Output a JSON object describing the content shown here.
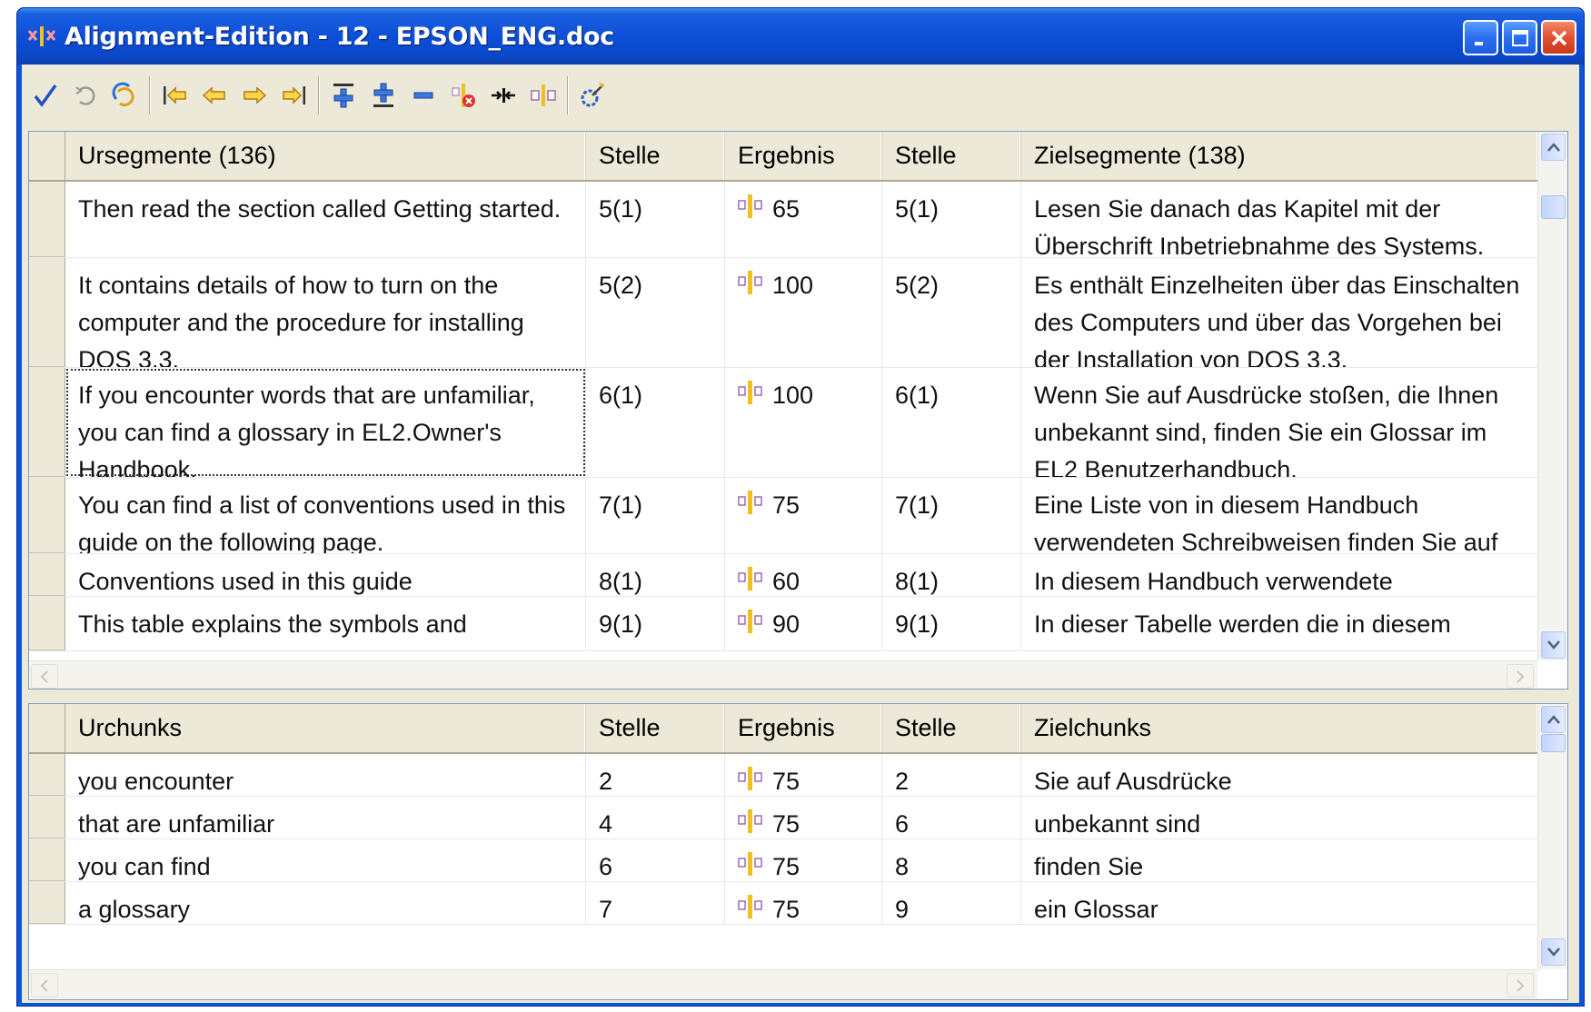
{
  "window": {
    "title": "Alignment-Edition - 12 - EPSON_ENG.doc",
    "buttons": [
      "minimize",
      "maximize",
      "close"
    ]
  },
  "toolbar": {
    "icons": [
      "confirm-check-icon",
      "refresh-icon",
      "refresh-all-icon",
      "first-icon",
      "previous-icon",
      "next-icon",
      "last-icon",
      "insert-above-icon",
      "insert-below-icon",
      "remove-icon",
      "delete-link-icon",
      "join-icon",
      "split-icon",
      "settings-wand-icon"
    ]
  },
  "segments": {
    "headers": [
      "Ursegmente (136)",
      "Stelle",
      "Ergebnis",
      "Stelle",
      "Zielsegmente (138)"
    ],
    "rows": [
      {
        "source": "Then read the section called Getting started.",
        "pos1": "5(1)",
        "score": "65",
        "pos2": "5(1)",
        "target": "Lesen Sie danach das Kapitel mit der Überschrift Inbetriebnahme des Systems."
      },
      {
        "source": " It contains details of how to turn on the computer and the procedure for installing DOS 3.3.",
        "pos1": "5(2)",
        "score": "100",
        "pos2": "5(2)",
        "target": " Es enthält Einzelheiten über das Einschalten des Computers und über das Vorgehen bei der Installation von DOS 3.3."
      },
      {
        "source": "If you encounter words that are unfamiliar, you can find a glossary in EL2.Owner's Handbook.",
        "pos1": "6(1)",
        "score": "100",
        "pos2": "6(1)",
        "target": "Wenn Sie auf Ausdrücke stoßen, die Ihnen unbekannt sind, finden Sie ein Glossar im EL2 Benutzerhandbuch."
      },
      {
        "source": "You can find a list of conventions used in this guide on the following page.",
        "pos1": "7(1)",
        "score": "75",
        "pos2": "7(1)",
        "target": "Eine Liste von in diesem Handbuch verwendeten Schreibweisen finden Sie auf der folgenden Seite."
      },
      {
        "source": "Conventions used in this guide",
        "pos1": "8(1)",
        "score": "60",
        "pos2": "8(1)",
        "target": "In diesem Handbuch verwendete Schreibweisen"
      },
      {
        "source": "This table explains the symbols and typefaces",
        "pos1": "9(1)",
        "score": "90",
        "pos2": "9(1)",
        "target": "In dieser Tabelle werden die in diesem Handbuch"
      }
    ]
  },
  "chunks": {
    "headers": [
      "Urchunks",
      "Stelle",
      "Ergebnis",
      "Stelle",
      "Zielchunks"
    ],
    "rows": [
      {
        "source": "you encounter",
        "pos1": "2",
        "score": "75",
        "pos2": "2",
        "target": "Sie auf Ausdrücke"
      },
      {
        "source": "that are unfamiliar",
        "pos1": "4",
        "score": "75",
        "pos2": "6",
        "target": "unbekannt sind"
      },
      {
        "source": "you can find",
        "pos1": "6",
        "score": "75",
        "pos2": "8",
        "target": "finden Sie"
      },
      {
        "source": "a glossary",
        "pos1": "7",
        "score": "75",
        "pos2": "9",
        "target": "ein Glossar"
      }
    ]
  }
}
